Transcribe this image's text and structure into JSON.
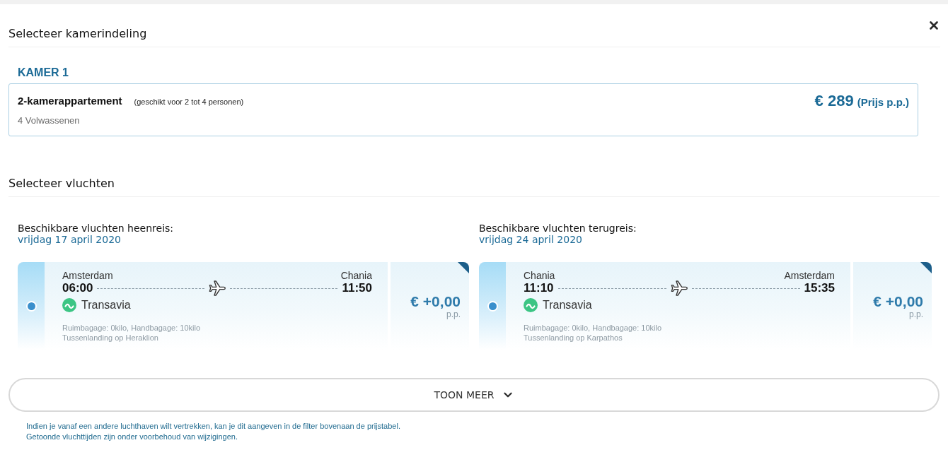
{
  "header": {
    "title": "Selecteer kamerindeling"
  },
  "rooms": [
    {
      "heading": "KAMER 1",
      "name": "2-kamerappartement",
      "capacity": "(geschikt voor 2 tot 4 personen)",
      "guests": "4 Volwassenen",
      "price": "€ 289",
      "price_note": "(Prijs p.p.)"
    }
  ],
  "flights": {
    "title": "Selecteer vluchten",
    "columns": [
      {
        "heading": "Beschikbare vluchten heenreis:",
        "date": "vrijdag 17 april 2020",
        "options": [
          {
            "selected": true,
            "from": "Amsterdam",
            "depart": "06:00",
            "to": "Chania",
            "arrive": "11:50",
            "airline": "Transavia",
            "baggage": "Ruimbagage: 0kilo, Handbagage: 10kilo",
            "stopover": "Tussenlanding op Heraklion",
            "price": "€ +0,00",
            "price_unit": "p.p."
          }
        ]
      },
      {
        "heading": "Beschikbare vluchten terugreis:",
        "date": "vrijdag 24 april 2020",
        "options": [
          {
            "selected": true,
            "from": "Chania",
            "depart": "11:10",
            "to": "Amsterdam",
            "arrive": "15:35",
            "airline": "Transavia",
            "baggage": "Ruimbagage: 0kilo, Handbagage: 10kilo",
            "stopover": "Tussenlanding op Karpathos",
            "price": "€ +0,00",
            "price_unit": "p.p."
          }
        ]
      }
    ]
  },
  "show_more": {
    "label": "TOON MEER"
  },
  "notes": [
    "Indien je vanaf een andere luchthaven wilt vertrekken, kan je dit aangeven in de filter bovenaan de prijstabel.",
    "Getoonde vluchttijden zijn onder voorbehoud van wijzigingen."
  ]
}
